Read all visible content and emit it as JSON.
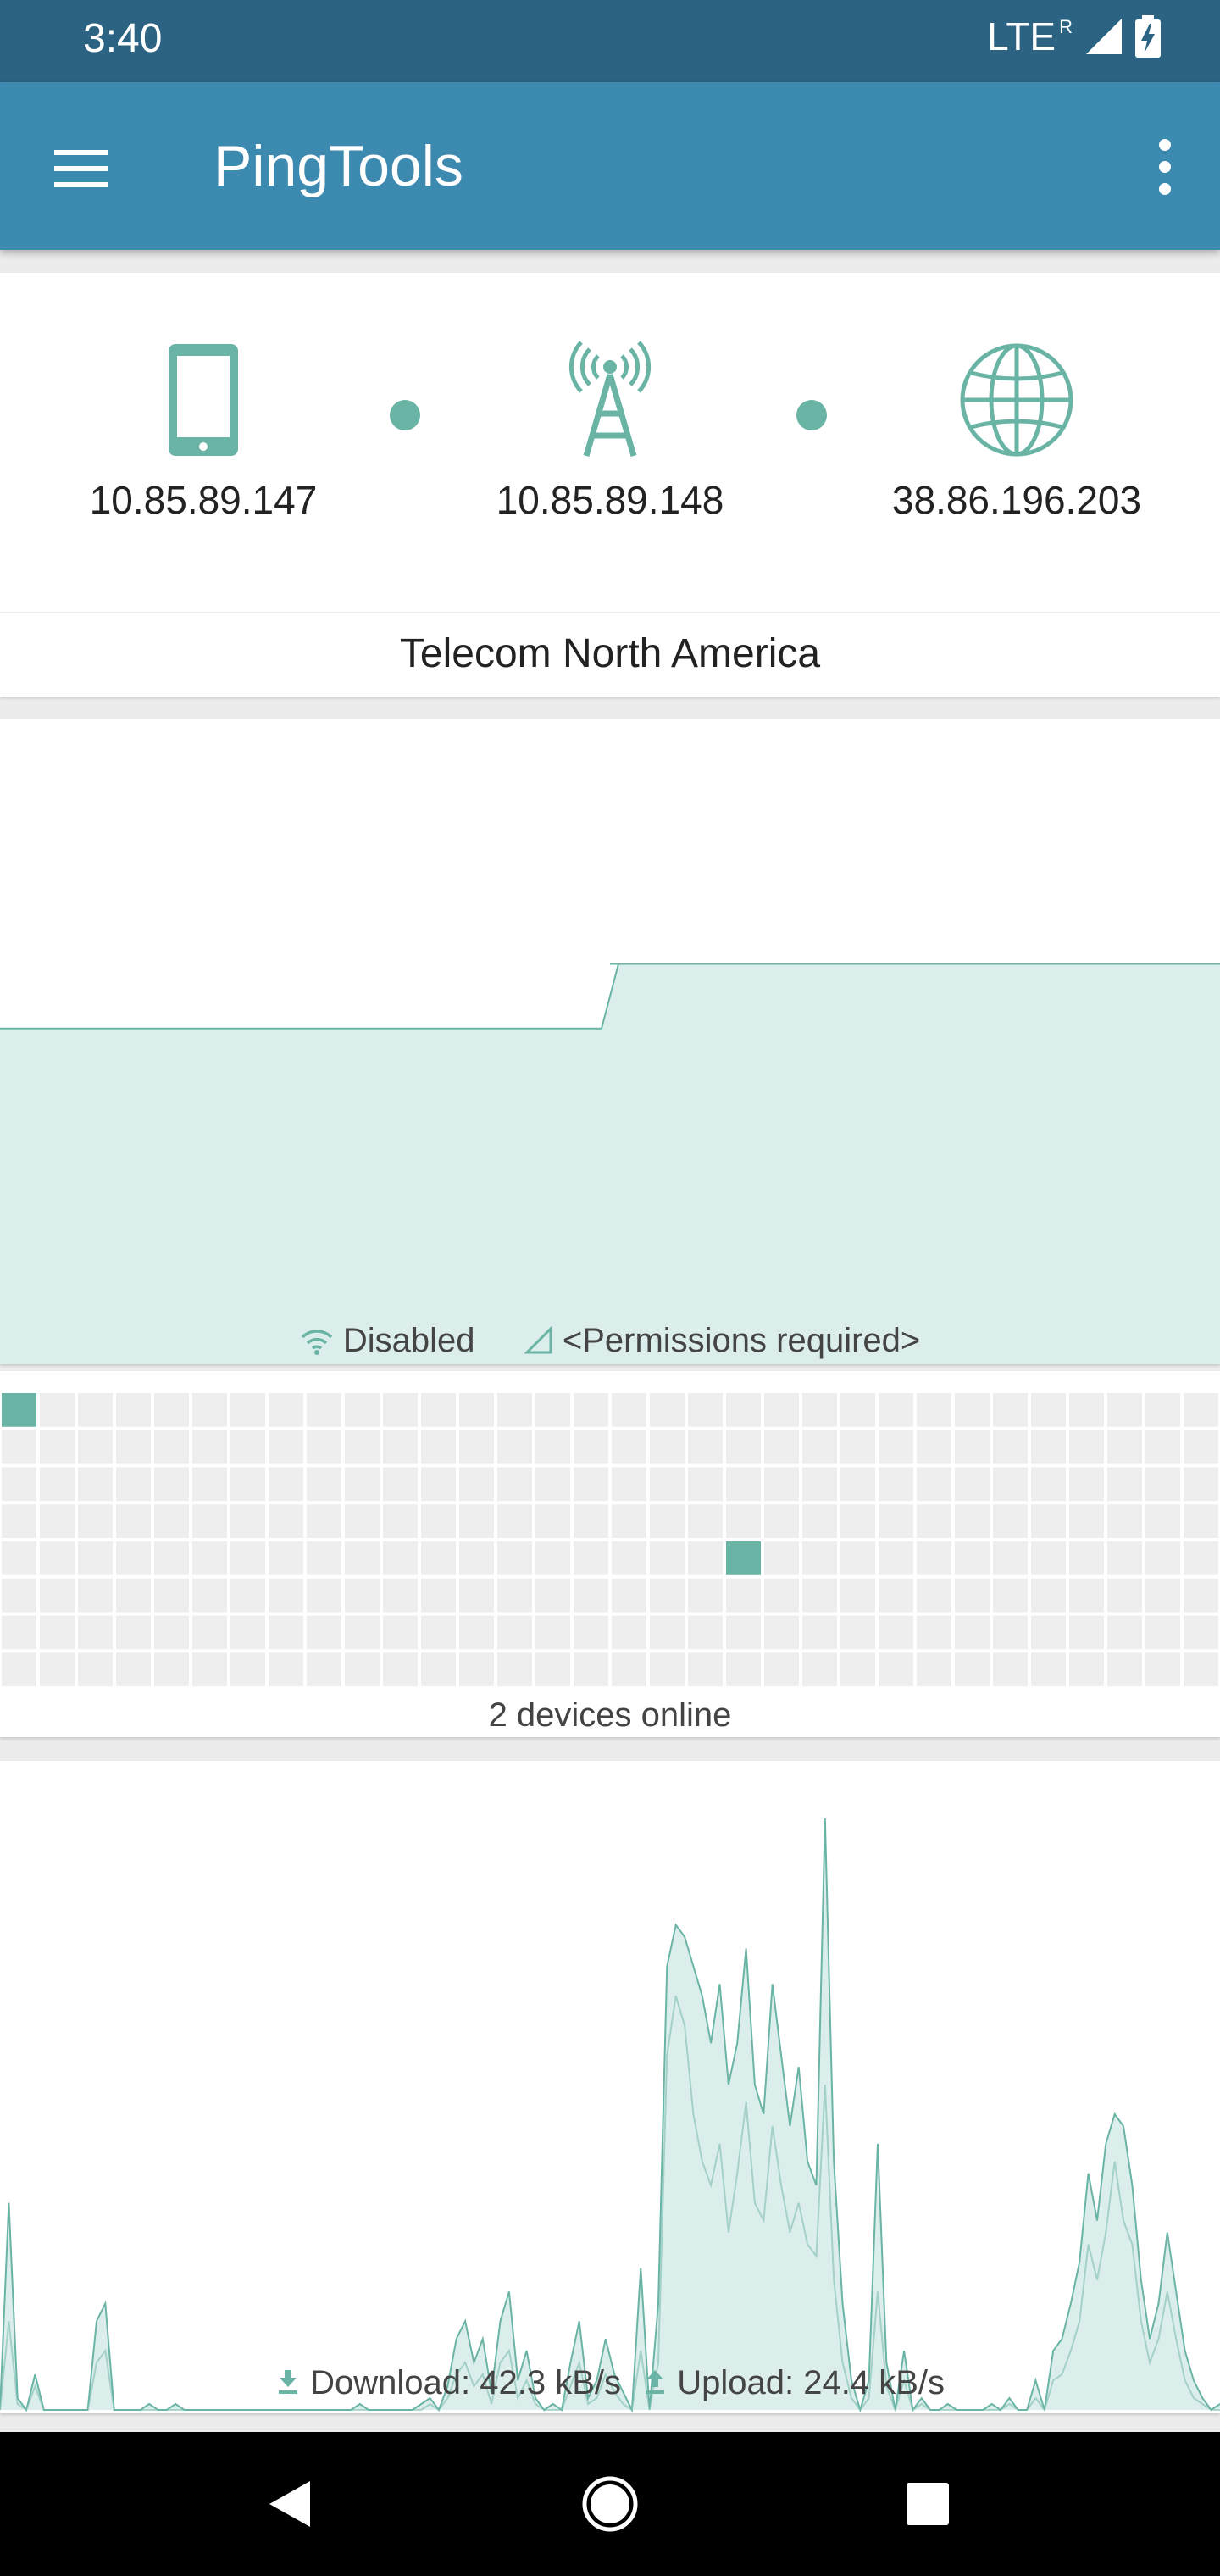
{
  "status_bar": {
    "time": "3:40",
    "network": "LTE",
    "roaming": "R"
  },
  "app_bar": {
    "title": "PingTools"
  },
  "network_path": {
    "nodes": [
      {
        "icon": "phone-icon",
        "ip": "10.85.89.147"
      },
      {
        "icon": "cell-tower-icon",
        "ip": "10.85.89.148"
      },
      {
        "icon": "globe-icon",
        "ip": "38.86.196.203"
      }
    ],
    "provider": "Telecom North America"
  },
  "signal_panel": {
    "wifi_status": "Disabled",
    "cell_status": "<Permissions required>",
    "levels": [
      0.52,
      0.52,
      0.52,
      0.52,
      0.52,
      0.52,
      0.52,
      0.52,
      0.62,
      0.62,
      0.62,
      0.62,
      0.62,
      0.62,
      0.62,
      0.62,
      0.62
    ]
  },
  "devices_panel": {
    "label": "2 devices online",
    "columns": 32,
    "rows": 8,
    "online_cells": [
      [
        0,
        0
      ],
      [
        19,
        4
      ]
    ]
  },
  "traffic_panel": {
    "download_label": "Download: 42.3 kB/s",
    "upload_label": "Upload: 24.4 kB/s",
    "download": [
      0.0,
      0.35,
      0.02,
      0.0,
      0.06,
      0.0,
      0.0,
      0.0,
      0.0,
      0.0,
      0.0,
      0.15,
      0.18,
      0.0,
      0.0,
      0.0,
      0.0,
      0.01,
      0.0,
      0.0,
      0.01,
      0.0,
      0.0,
      0.0,
      0.0,
      0.0,
      0.0,
      0.0,
      0.0,
      0.0,
      0.0,
      0.0,
      0.0,
      0.0,
      0.0,
      0.0,
      0.0,
      0.0,
      0.0,
      0.0,
      0.0,
      0.01,
      0.0,
      0.0,
      0.0,
      0.0,
      0.0,
      0.0,
      0.01,
      0.02,
      0.0,
      0.04,
      0.12,
      0.15,
      0.08,
      0.12,
      0.03,
      0.15,
      0.2,
      0.05,
      0.1,
      0.02,
      0.0,
      0.01,
      0.0,
      0.08,
      0.15,
      0.02,
      0.05,
      0.12,
      0.06,
      0.03,
      0.0,
      0.24,
      0.0,
      0.18,
      0.75,
      0.82,
      0.8,
      0.75,
      0.7,
      0.62,
      0.72,
      0.55,
      0.62,
      0.78,
      0.55,
      0.5,
      0.72,
      0.6,
      0.48,
      0.58,
      0.42,
      0.38,
      1.0,
      0.42,
      0.18,
      0.05,
      0.0,
      0.05,
      0.45,
      0.08,
      0.0,
      0.1,
      0.0,
      0.02,
      0.0,
      0.0,
      0.01,
      0.0,
      0.0,
      0.0,
      0.0,
      0.01,
      0.0,
      0.02,
      0.0,
      0.0,
      0.05,
      0.0,
      0.1,
      0.12,
      0.18,
      0.25,
      0.4,
      0.32,
      0.45,
      0.5,
      0.48,
      0.38,
      0.22,
      0.12,
      0.18,
      0.3,
      0.2,
      0.1,
      0.05,
      0.02,
      0.0,
      0.01
    ],
    "upload": [
      0.0,
      0.15,
      0.01,
      0.0,
      0.04,
      0.0,
      0.0,
      0.0,
      0.0,
      0.0,
      0.0,
      0.08,
      0.1,
      0.0,
      0.0,
      0.0,
      0.0,
      0.0,
      0.0,
      0.0,
      0.0,
      0.0,
      0.0,
      0.0,
      0.0,
      0.0,
      0.0,
      0.0,
      0.0,
      0.0,
      0.0,
      0.0,
      0.0,
      0.0,
      0.0,
      0.0,
      0.0,
      0.0,
      0.0,
      0.0,
      0.0,
      0.0,
      0.0,
      0.0,
      0.0,
      0.0,
      0.0,
      0.0,
      0.0,
      0.01,
      0.0,
      0.02,
      0.06,
      0.08,
      0.04,
      0.06,
      0.01,
      0.08,
      0.1,
      0.02,
      0.05,
      0.01,
      0.0,
      0.0,
      0.0,
      0.04,
      0.08,
      0.01,
      0.02,
      0.06,
      0.03,
      0.01,
      0.0,
      0.1,
      0.0,
      0.08,
      0.6,
      0.7,
      0.65,
      0.5,
      0.42,
      0.38,
      0.45,
      0.3,
      0.4,
      0.52,
      0.35,
      0.32,
      0.48,
      0.38,
      0.3,
      0.35,
      0.28,
      0.26,
      0.55,
      0.22,
      0.08,
      0.02,
      0.0,
      0.02,
      0.2,
      0.04,
      0.0,
      0.05,
      0.0,
      0.01,
      0.0,
      0.0,
      0.0,
      0.0,
      0.0,
      0.0,
      0.0,
      0.0,
      0.0,
      0.01,
      0.0,
      0.0,
      0.02,
      0.0,
      0.05,
      0.06,
      0.1,
      0.15,
      0.28,
      0.22,
      0.3,
      0.42,
      0.32,
      0.28,
      0.15,
      0.08,
      0.12,
      0.2,
      0.12,
      0.05,
      0.02,
      0.01,
      0.0,
      0.0
    ]
  },
  "colors": {
    "status_bar": "#2c6382",
    "app_bar": "#3d8ab1",
    "accent": "#6ab4a6",
    "fill": "#dceeeb",
    "grid_cell": "#eeeeee"
  }
}
